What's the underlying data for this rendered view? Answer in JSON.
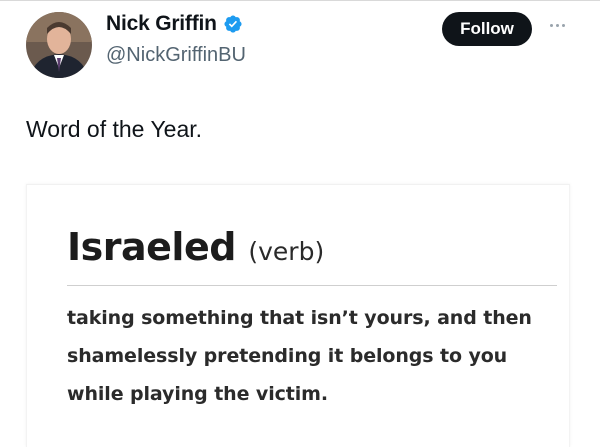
{
  "tweet": {
    "author": {
      "display_name": "Nick Griffin",
      "handle": "@NickGriffinBU",
      "verified_icon": "verified-badge-icon",
      "avatar_icon": "profile-photo"
    },
    "follow_label": "Follow",
    "more_icon": "more-options-icon",
    "text": "Word of the Year.",
    "card": {
      "word": "Israeled",
      "part_of_speech": "(verb)",
      "definition": "taking something that isn’t yours, and then shamelessly pretending it belongs to you while playing the victim."
    }
  },
  "colors": {
    "follow_bg": "#0f1419",
    "verified": "#1d9bf0",
    "handle": "#536471"
  }
}
